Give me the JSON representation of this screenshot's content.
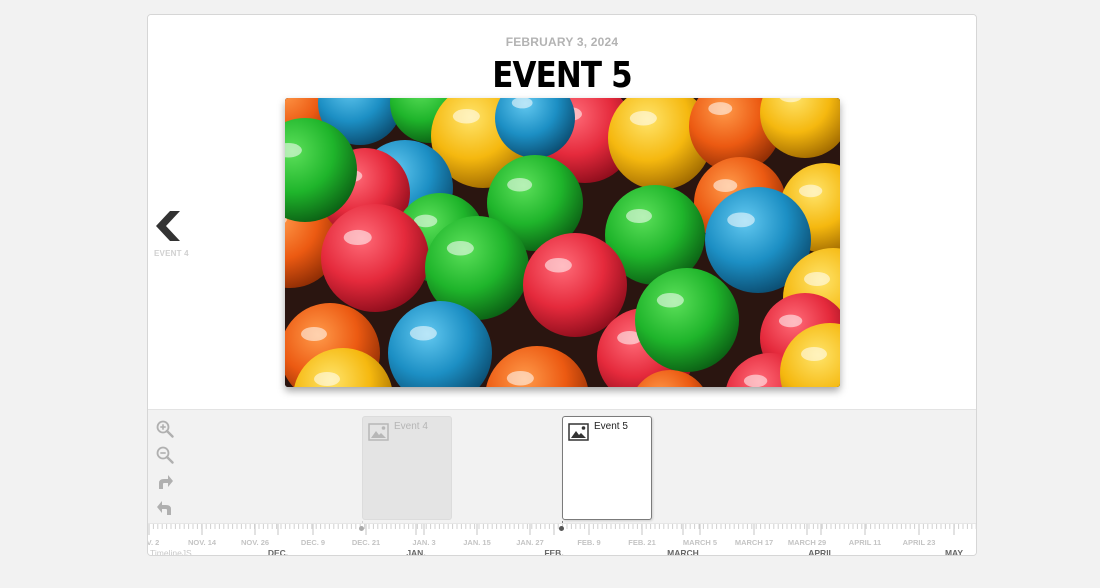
{
  "slide": {
    "date": "FEBRUARY 3, 2024",
    "title": "EVENT 5",
    "media_subject": "colorful gumballs"
  },
  "nav_previous": {
    "icon": "chevron-left-icon",
    "label": "EVENT 4"
  },
  "menu": {
    "zoom_in_icon": "zoom-in-icon",
    "zoom_out_icon": "zoom-out-icon",
    "forward_icon": "redo-icon",
    "back_icon": "undo-icon"
  },
  "markers": [
    {
      "label": "Event 4",
      "icon": "image-icon",
      "active": false
    },
    {
      "label": "Event 5",
      "icon": "image-icon",
      "active": true
    }
  ],
  "axis": {
    "minor_ticks": [
      "V. 2",
      "NOV. 14",
      "NOV. 26",
      "DEC. 9",
      "DEC. 21",
      "JAN. 3",
      "JAN. 15",
      "JAN. 27",
      "FEB. 9",
      "FEB. 21",
      "MARCH 5",
      "MARCH 17",
      "MARCH 29",
      "APRIL 11",
      "APRIL 23"
    ],
    "major_ticks": [
      "DEC.",
      "JAN.",
      "FEB.",
      "MARCH",
      "APRIL",
      "MAY"
    ],
    "credit": "TimelineJS"
  },
  "colors": {
    "background": "#f2f2f2",
    "title": "#000000",
    "date": "#b3b3b3",
    "marker_active_border": "#7b7b7b"
  }
}
